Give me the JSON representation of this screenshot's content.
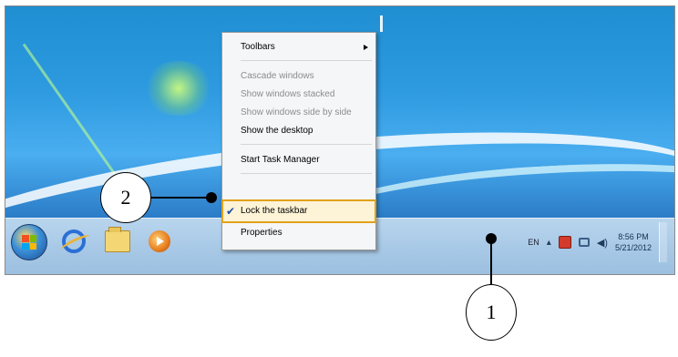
{
  "context_menu": {
    "items": [
      {
        "label": "Toolbars"
      },
      {
        "label": "Cascade windows"
      },
      {
        "label": "Show windows stacked"
      },
      {
        "label": "Show windows side by side"
      },
      {
        "label": "Show the desktop"
      },
      {
        "label": "Start Task Manager"
      },
      {
        "label": "Lock the taskbar"
      },
      {
        "label": "Properties"
      }
    ]
  },
  "tray": {
    "language": "EN",
    "time": "8:56 PM",
    "date": "5/21/2012"
  },
  "callouts": {
    "one": "1",
    "two": "2"
  },
  "colors": {
    "highlight_border": "#e2a11a",
    "taskbar": "#a8c9e6",
    "desktop": "#2e9ae0"
  },
  "icons": {
    "start": "windows-orb-icon",
    "browser": "internet-explorer-icon",
    "files": "folder-icon",
    "media": "media-player-icon",
    "check": "checkmark-icon"
  }
}
